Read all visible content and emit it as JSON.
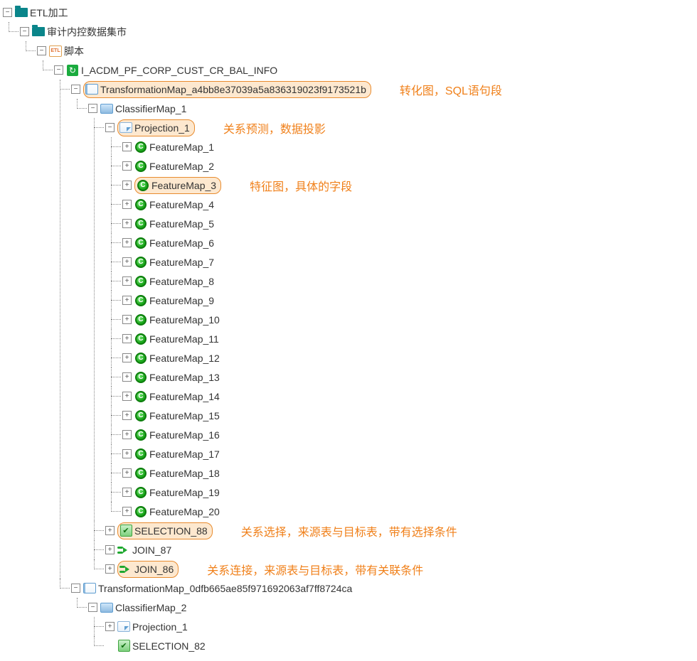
{
  "tree": {
    "root": "ETL加工",
    "l2": "审计内控数据集市",
    "l3": "脚本",
    "l3_icon_text": "ETL",
    "l4": "I_ACDM_PF_CORP_CUST_CR_BAL_INFO",
    "tmap1": "TransformationMap_a4bb8e37039a5a836319023f9173521b",
    "tmap2": "TransformationMap_0dfb665ae85f971692063af7ff8724ca",
    "cmap1": "ClassifierMap_1",
    "cmap2": "ClassifierMap_2",
    "proj1": "Projection_1",
    "proj2": "Projection_1",
    "sel88": "SELECTION_88",
    "sel82": "SELECTION_82",
    "join87": "JOIN_87",
    "join86": "JOIN_86",
    "feat_icon_letter": "C",
    "features": [
      "FeatureMap_1",
      "FeatureMap_2",
      "FeatureMap_3",
      "FeatureMap_4",
      "FeatureMap_5",
      "FeatureMap_6",
      "FeatureMap_7",
      "FeatureMap_8",
      "FeatureMap_9",
      "FeatureMap_10",
      "FeatureMap_11",
      "FeatureMap_12",
      "FeatureMap_13",
      "FeatureMap_14",
      "FeatureMap_15",
      "FeatureMap_16",
      "FeatureMap_17",
      "FeatureMap_18",
      "FeatureMap_19",
      "FeatureMap_20"
    ]
  },
  "annotations": {
    "tmap": "转化图，SQL语句段",
    "proj": "关系预测，数据投影",
    "feat": "特征图，具体的字段",
    "sel": "关系选择，来源表与目标表，带有选择条件",
    "join": "关系连接，来源表与目标表，带有关联条件"
  }
}
